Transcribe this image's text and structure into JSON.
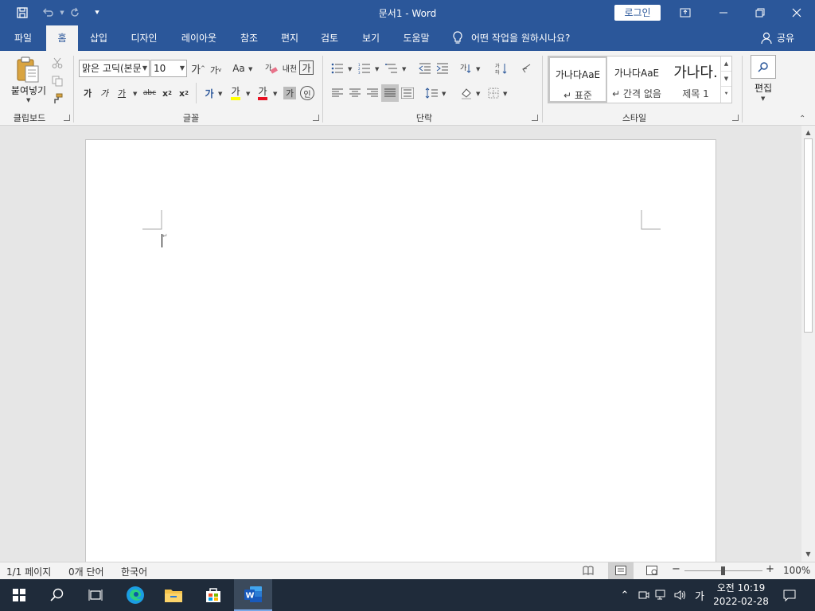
{
  "titlebar": {
    "title": "문서1  -  Word",
    "login_label": "로그인",
    "qat": [
      "save-icon",
      "undo-icon",
      "redo-icon",
      "customize-icon"
    ]
  },
  "tabs": [
    {
      "label": "파일",
      "active": false
    },
    {
      "label": "홈",
      "active": true
    },
    {
      "label": "삽입",
      "active": false
    },
    {
      "label": "디자인",
      "active": false
    },
    {
      "label": "레이아웃",
      "active": false
    },
    {
      "label": "참조",
      "active": false
    },
    {
      "label": "편지",
      "active": false
    },
    {
      "label": "검토",
      "active": false
    },
    {
      "label": "보기",
      "active": false
    },
    {
      "label": "도움말",
      "active": false
    }
  ],
  "tellme": {
    "placeholder": "어떤 작업을 원하시나요?"
  },
  "share_label": "공유",
  "ribbon": {
    "clipboard": {
      "label": "클립보드",
      "paste_label": "붙여넣기"
    },
    "font": {
      "label": "글꼴",
      "font_name": "맑은 고딕(본문",
      "font_size": "10",
      "grow": "가",
      "shrink": "가",
      "change_case": "Aa",
      "phonetic": "내천",
      "char_border": "가",
      "bold": "가",
      "italic": "가",
      "underline": "가",
      "strike": "abc",
      "sub": "x",
      "sup": "x",
      "text_effects": "가",
      "highlight": "가",
      "font_color": "가",
      "char_shading": "가",
      "enclose": "인"
    },
    "paragraph": {
      "label": "단락"
    },
    "styles": {
      "label": "스타일",
      "items": [
        {
          "preview": "가나다AaE",
          "name": "↵ 표준"
        },
        {
          "preview": "가나다AaE",
          "name": "↵ 간격 없음"
        },
        {
          "preview": "가나다.",
          "name": "제목 1"
        }
      ]
    },
    "editing": {
      "label": "편집"
    }
  },
  "statusbar": {
    "page": "1/1 페이지",
    "words": "0개 단어",
    "language": "한국어",
    "zoom": "100%",
    "zoom_minus": "−",
    "zoom_plus": "+"
  },
  "taskbar": {
    "time": "오전 10:19",
    "date": "2022-02-28",
    "ime": "가"
  },
  "colors": {
    "accent": "#2b579a",
    "highlight_yellow": "#ffff00",
    "font_red": "#e81123"
  }
}
